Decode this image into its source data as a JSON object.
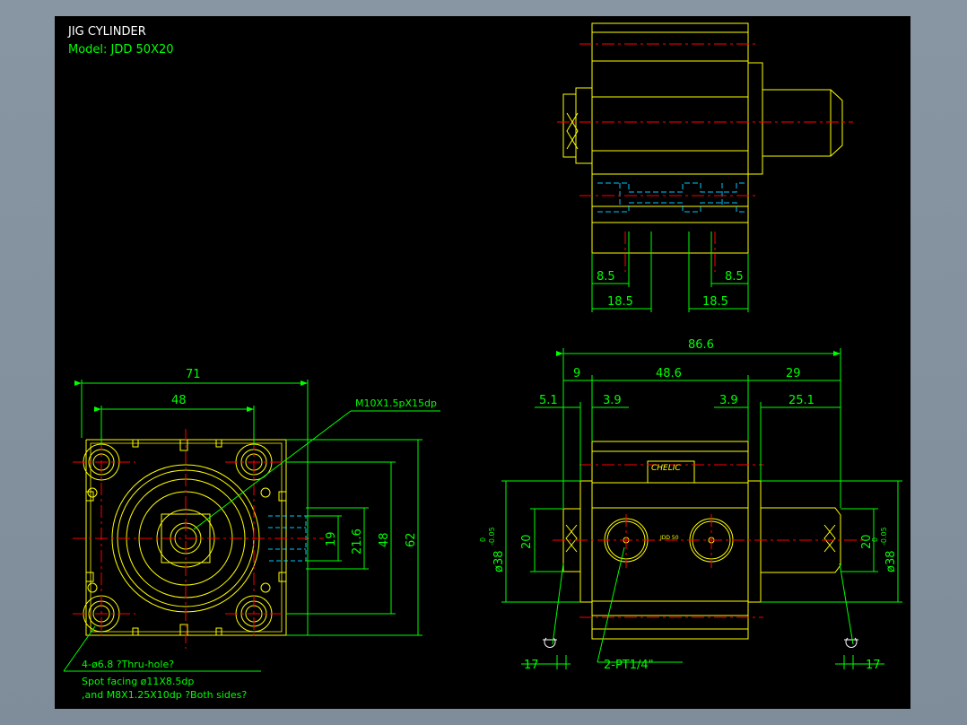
{
  "title": {
    "line1": "JIG CYLINDER",
    "line2": "Model:  JDD 50X20"
  },
  "colors": {
    "background": "#000000",
    "frame": "#8d9aa7",
    "outline": "#ffff00",
    "dimension": "#00ff00",
    "centerline": "#ff0000",
    "hidden": "#00c8ff",
    "text_white": "#ffffff"
  },
  "top_view": {
    "dims": {
      "left_a": "8.5",
      "right_a": "8.5",
      "left_b": "18.5",
      "right_b": "18.5"
    }
  },
  "front_view": {
    "dims": {
      "overall_width": "71",
      "bolt_spacing": "48",
      "height_inner": "48",
      "height_overall": "62",
      "port_a": "19",
      "port_b": "21.6"
    },
    "callouts": {
      "thread": "M10X1.5pX15dp",
      "holes_1": "4-ø6.8 ?Thru-hole?",
      "holes_2": "Spot facing  ø11X8.5dp",
      "holes_3": ",and M8X1.25X10dp ?Both sides?"
    }
  },
  "side_view": {
    "dims": {
      "overall_length": "86.6",
      "left_seg": "9",
      "mid_seg": "48.6",
      "right_seg": "29",
      "left_sub": "5.1",
      "left_sub2": "3.9",
      "right_sub": "3.9",
      "right_sub2": "25.1",
      "rod_left": "20",
      "rod_right": "20",
      "bore_left": "ø38",
      "bore_right": "ø38",
      "tol_left_top": "0",
      "tol_left_bot": "-0.05",
      "tol_right_top": "0",
      "tol_right_bot": "-0.05",
      "wrench_left": "17",
      "wrench_right": "17",
      "ports": "2-PT1/4\""
    },
    "label": {
      "brand": "CHELIC",
      "small": "JDD 50"
    }
  }
}
